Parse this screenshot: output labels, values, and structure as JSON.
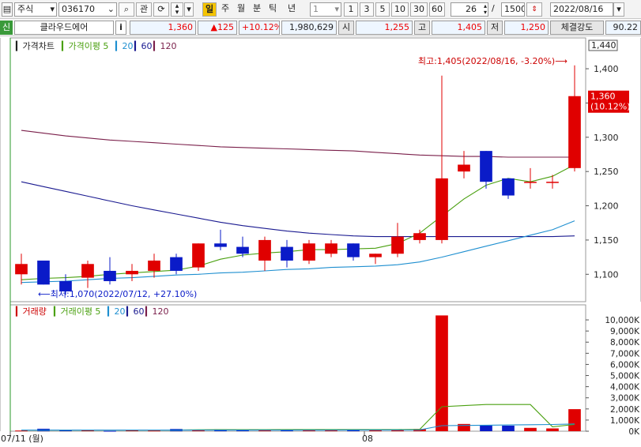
{
  "toolbar": {
    "market": "주식",
    "code": "036170",
    "watch": "관",
    "period_day": "일",
    "period_week": "주",
    "period_month": "월",
    "period_min": "분",
    "period_tick": "틱",
    "period_year": "년",
    "interval": "1",
    "presets": [
      "1",
      "3",
      "5",
      "10",
      "30",
      "60"
    ],
    "count": "26",
    "count_sep": "/",
    "total": "1500",
    "date": "2022/08/16"
  },
  "quote": {
    "badge": "신",
    "name": "클라우드에어",
    "info": "i",
    "price": "1,360",
    "change": "▲125",
    "change_pct": "+10.12%",
    "volume": "1,980,629",
    "open_label": "시",
    "open": "1,255",
    "high_label": "고",
    "high": "1,405",
    "low_label": "저",
    "low": "1,250",
    "strength_label": "체결강도",
    "strength": "90.22"
  },
  "colors": {
    "up": "#e00000",
    "down": "#0a1bc8",
    "ma5": "#4aa010",
    "ma20": "#1e8fd0",
    "ma60": "#1a1a90",
    "ma120": "#7a1f4a"
  },
  "chart_data": {
    "type": "candlestick",
    "price_legend": {
      "title": "가격차트",
      "ma_title": "가격이평",
      "periods": [
        "5",
        "20",
        "60",
        "120"
      ]
    },
    "volume_legend": {
      "title": "거래량",
      "ma_title": "거래이평",
      "periods": [
        "5",
        "20",
        "60",
        "120"
      ]
    },
    "y_ticks": [
      "1,400",
      "1,350",
      "1,300",
      "1,250",
      "1,200",
      "1,150",
      "1,100"
    ],
    "y_top_label": "1,440",
    "current_label": "1,360",
    "current_pct": "(10.12%)",
    "high_annotation": "최고:1,405(2022/08/16, -3.20%)⟶",
    "low_annotation": "⟵최저:1,070(2022/07/12, +27.10%)",
    "vol_ticks": [
      "10,000K",
      "9,000K",
      "8,000K",
      "7,000K",
      "6,000K",
      "5,000K",
      "4,000K",
      "3,000K",
      "2,000K",
      "1,000K",
      "0K"
    ],
    "x_labels": [
      "07/11 (월)",
      "08"
    ],
    "ylim": [
      1060,
      1445
    ],
    "vol_max": 10500,
    "candles": [
      {
        "o": 1100,
        "h": 1130,
        "l": 1085,
        "c": 1115
      },
      {
        "o": 1120,
        "h": 1120,
        "l": 1085,
        "c": 1085
      },
      {
        "o": 1090,
        "h": 1100,
        "l": 1070,
        "c": 1075
      },
      {
        "o": 1095,
        "h": 1120,
        "l": 1080,
        "c": 1115
      },
      {
        "o": 1105,
        "h": 1125,
        "l": 1085,
        "c": 1090
      },
      {
        "o": 1100,
        "h": 1115,
        "l": 1090,
        "c": 1105
      },
      {
        "o": 1105,
        "h": 1130,
        "l": 1095,
        "c": 1120
      },
      {
        "o": 1125,
        "h": 1130,
        "l": 1100,
        "c": 1105
      },
      {
        "o": 1110,
        "h": 1145,
        "l": 1105,
        "c": 1145
      },
      {
        "o": 1145,
        "h": 1165,
        "l": 1135,
        "c": 1140
      },
      {
        "o": 1140,
        "h": 1155,
        "l": 1125,
        "c": 1130
      },
      {
        "o": 1120,
        "h": 1155,
        "l": 1105,
        "c": 1150
      },
      {
        "o": 1140,
        "h": 1150,
        "l": 1110,
        "c": 1120
      },
      {
        "o": 1120,
        "h": 1150,
        "l": 1115,
        "c": 1145
      },
      {
        "o": 1130,
        "h": 1150,
        "l": 1125,
        "c": 1145
      },
      {
        "o": 1145,
        "h": 1145,
        "l": 1120,
        "c": 1125
      },
      {
        "o": 1125,
        "h": 1130,
        "l": 1115,
        "c": 1130
      },
      {
        "o": 1130,
        "h": 1175,
        "l": 1125,
        "c": 1155
      },
      {
        "o": 1150,
        "h": 1165,
        "l": 1145,
        "c": 1160
      },
      {
        "o": 1150,
        "h": 1390,
        "l": 1145,
        "c": 1240
      },
      {
        "o": 1250,
        "h": 1280,
        "l": 1240,
        "c": 1260
      },
      {
        "o": 1280,
        "h": 1280,
        "l": 1225,
        "c": 1235
      },
      {
        "o": 1240,
        "h": 1240,
        "l": 1210,
        "c": 1215
      },
      {
        "o": 1235,
        "h": 1255,
        "l": 1225,
        "c": 1235
      },
      {
        "o": 1235,
        "h": 1245,
        "l": 1225,
        "c": 1235
      },
      {
        "o": 1255,
        "h": 1405,
        "l": 1250,
        "c": 1360
      }
    ],
    "volumes": [
      60,
      220,
      80,
      90,
      30,
      120,
      60,
      200,
      110,
      180,
      150,
      160,
      140,
      130,
      120,
      180,
      120,
      160,
      200,
      10400,
      650,
      520,
      500,
      300,
      250,
      1980
    ],
    "ma5": [
      1092,
      1094,
      1095,
      1097,
      1100,
      1102,
      1104,
      1106,
      1112,
      1122,
      1128,
      1131,
      1133,
      1136,
      1136,
      1137,
      1138,
      1145,
      1160,
      1185,
      1210,
      1230,
      1240,
      1235,
      1243,
      1260
    ],
    "ma20": [
      1088,
      1089,
      1090,
      1092,
      1094,
      1095,
      1097,
      1099,
      1100,
      1102,
      1103,
      1105,
      1107,
      1108,
      1110,
      1111,
      1112,
      1114,
      1118,
      1125,
      1133,
      1141,
      1149,
      1157,
      1165,
      1178
    ],
    "ma60": [
      1235,
      1228,
      1221,
      1214,
      1207,
      1200,
      1194,
      1188,
      1182,
      1176,
      1171,
      1167,
      1163,
      1160,
      1158,
      1156,
      1155,
      1155,
      1155,
      1155,
      1155,
      1155,
      1155,
      1155,
      1155,
      1156
    ],
    "ma120": [
      1310,
      1306,
      1302,
      1299,
      1296,
      1294,
      1292,
      1290,
      1288,
      1286,
      1285,
      1284,
      1283,
      1282,
      1281,
      1280,
      1278,
      1276,
      1274,
      1273,
      1272,
      1272,
      1271,
      1271,
      1271,
      1271
    ],
    "vol_ma5": [
      100,
      100,
      100,
      100,
      100,
      100,
      100,
      100,
      130,
      140,
      140,
      140,
      150,
      150,
      150,
      150,
      150,
      150,
      160,
      2200,
      2300,
      2400,
      2400,
      2400,
      400,
      600
    ],
    "vol_ma20": [
      100,
      100,
      100,
      100,
      100,
      100,
      100,
      100,
      100,
      100,
      100,
      100,
      100,
      100,
      100,
      110,
      110,
      110,
      120,
      500,
      520,
      540,
      560,
      580,
      600,
      650
    ]
  }
}
